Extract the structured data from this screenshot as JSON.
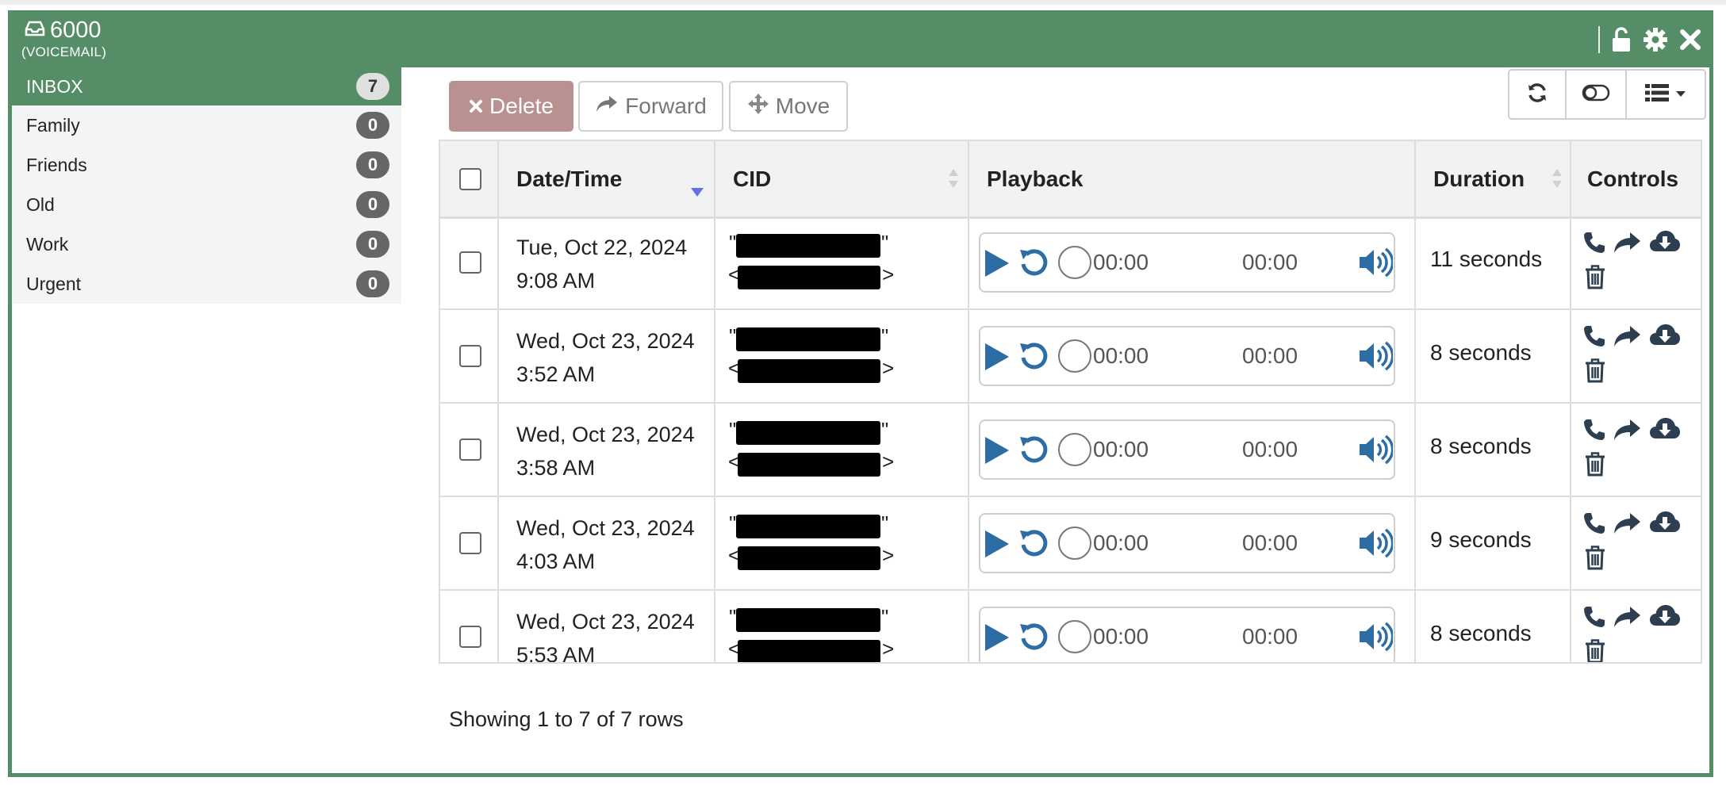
{
  "window": {
    "title": "6000",
    "subtitle": "(VOICEMAIL)",
    "icons": [
      "inbox-icon",
      "unlock-icon",
      "gear-icon",
      "close-icon"
    ]
  },
  "folders": [
    {
      "label": "INBOX",
      "count": "7",
      "active": true
    },
    {
      "label": "Family",
      "count": "0"
    },
    {
      "label": "Friends",
      "count": "0"
    },
    {
      "label": "Old",
      "count": "0"
    },
    {
      "label": "Work",
      "count": "0"
    },
    {
      "label": "Urgent",
      "count": "0"
    }
  ],
  "toolbar": {
    "delete_label": "Delete",
    "forward_label": "Forward",
    "move_label": "Move",
    "right_icons": [
      "refresh-icon",
      "toggle-icon",
      "columns-icon"
    ]
  },
  "table": {
    "headers": {
      "datetime": "Date/Time",
      "cid": "CID",
      "playback": "Playback",
      "duration": "Duration",
      "controls": "Controls"
    },
    "rows": [
      {
        "date": "Tue, Oct 22, 2024",
        "time": "9:08 AM",
        "current": "00:00",
        "total": "00:00",
        "duration": "11 seconds"
      },
      {
        "date": "Wed, Oct 23, 2024",
        "time": "3:52 AM",
        "current": "00:00",
        "total": "00:00",
        "duration": "8 seconds"
      },
      {
        "date": "Wed, Oct 23, 2024",
        "time": "3:58 AM",
        "current": "00:00",
        "total": "00:00",
        "duration": "8 seconds"
      },
      {
        "date": "Wed, Oct 23, 2024",
        "time": "4:03 AM",
        "current": "00:00",
        "total": "00:00",
        "duration": "9 seconds"
      },
      {
        "date": "Wed, Oct 23, 2024",
        "time": "5:53 AM",
        "current": "00:00",
        "total": "00:00",
        "duration": "8 seconds"
      }
    ]
  },
  "footer": {
    "text": "Showing 1 to 7 of 7 rows"
  },
  "colors": {
    "brand": "#558e66",
    "player_blue": "#2e6da4",
    "delete": "#b99190"
  }
}
